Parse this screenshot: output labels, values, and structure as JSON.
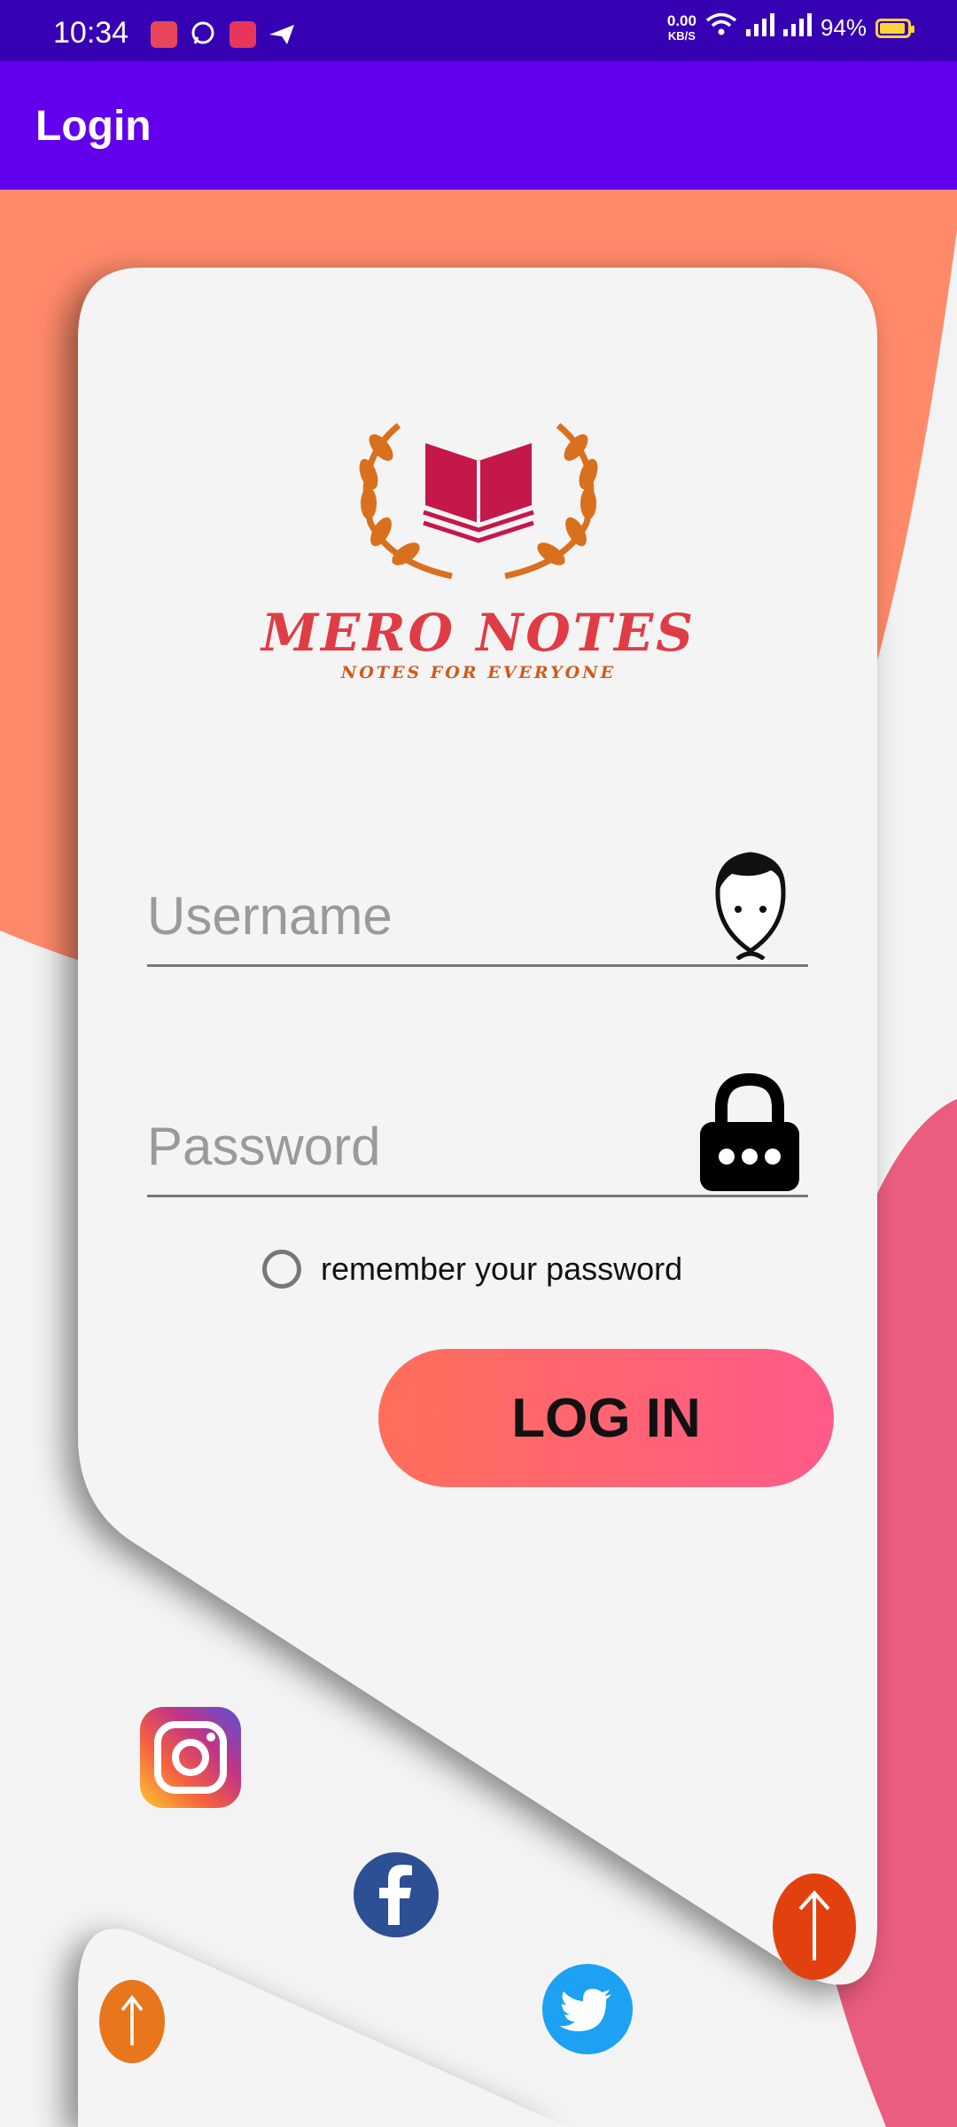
{
  "status_bar": {
    "time": "10:34",
    "net_speed_value": "0.00",
    "net_speed_unit": "KB/S",
    "battery_percent": "94%"
  },
  "app_bar": {
    "title": "Login"
  },
  "brand": {
    "name": "MERO NOTES",
    "tagline": "NOTES FOR EVERYONE"
  },
  "form": {
    "username_placeholder": "Username",
    "username_value": "",
    "password_placeholder": "Password",
    "password_value": "",
    "remember_label": "remember your password",
    "remember_checked": false,
    "login_label": "LOG IN"
  },
  "social": [
    "instagram",
    "facebook",
    "twitter"
  ],
  "colors": {
    "status_bar": "#3600b3",
    "app_bar": "#6200ee",
    "accent_orange": "#ff8a6a",
    "accent_pink": "#ea5d7e",
    "login_gradient_start": "#ff6e5a",
    "login_gradient_end": "#ff5a8a",
    "fab_orange_dark": "#e2410f",
    "fab_orange": "#e8761c"
  }
}
